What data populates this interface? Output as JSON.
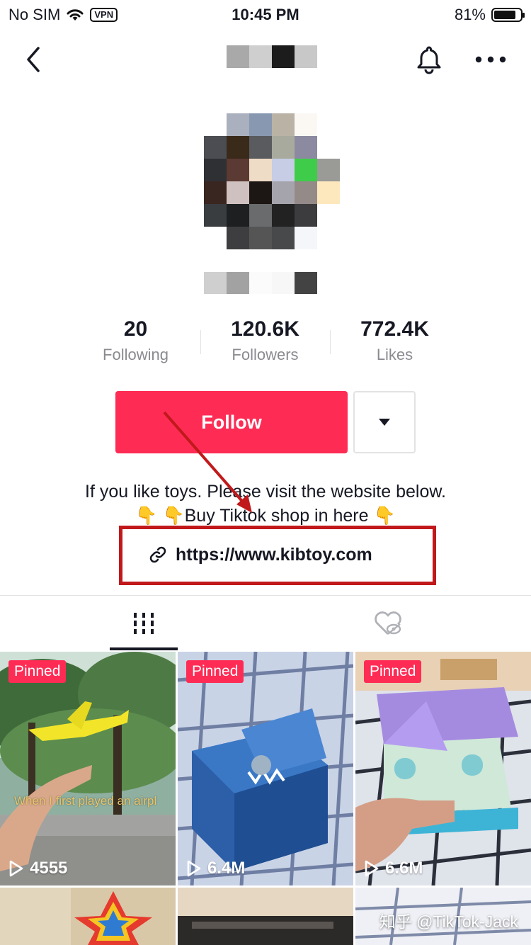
{
  "status_bar": {
    "carrier": "No SIM",
    "vpn": "VPN",
    "time": "10:45 PM",
    "battery": "81%",
    "battery_level": 0.81
  },
  "stats": {
    "following": {
      "value": "20",
      "label": "Following"
    },
    "followers": {
      "value": "120.6K",
      "label": "Followers"
    },
    "likes": {
      "value": "772.4K",
      "label": "Likes"
    }
  },
  "actions": {
    "follow_label": "Follow"
  },
  "bio": {
    "line1": "If you like toys. Please visit the website below.",
    "line2_text": "Buy Tiktok shop in here",
    "link": "https://www.kibtoy.com"
  },
  "videos": [
    {
      "pinned": "Pinned",
      "views": "4555",
      "caption": "When I first played an airpl"
    },
    {
      "pinned": "Pinned",
      "views": "6.4M"
    },
    {
      "pinned": "Pinned",
      "views": "6.6M"
    }
  ],
  "watermark": "知乎 @TikTok-Jack",
  "colors": {
    "accent": "#fe2c55",
    "highlight_box": "#c1191b"
  },
  "icons": {
    "back": "chevron-left-icon",
    "bell": "bell-icon",
    "more": "more-icon",
    "dropdown": "caret-down-icon",
    "link": "link-icon",
    "grid": "grid-icon",
    "liked": "liked-hidden-icon",
    "play": "play-icon"
  }
}
